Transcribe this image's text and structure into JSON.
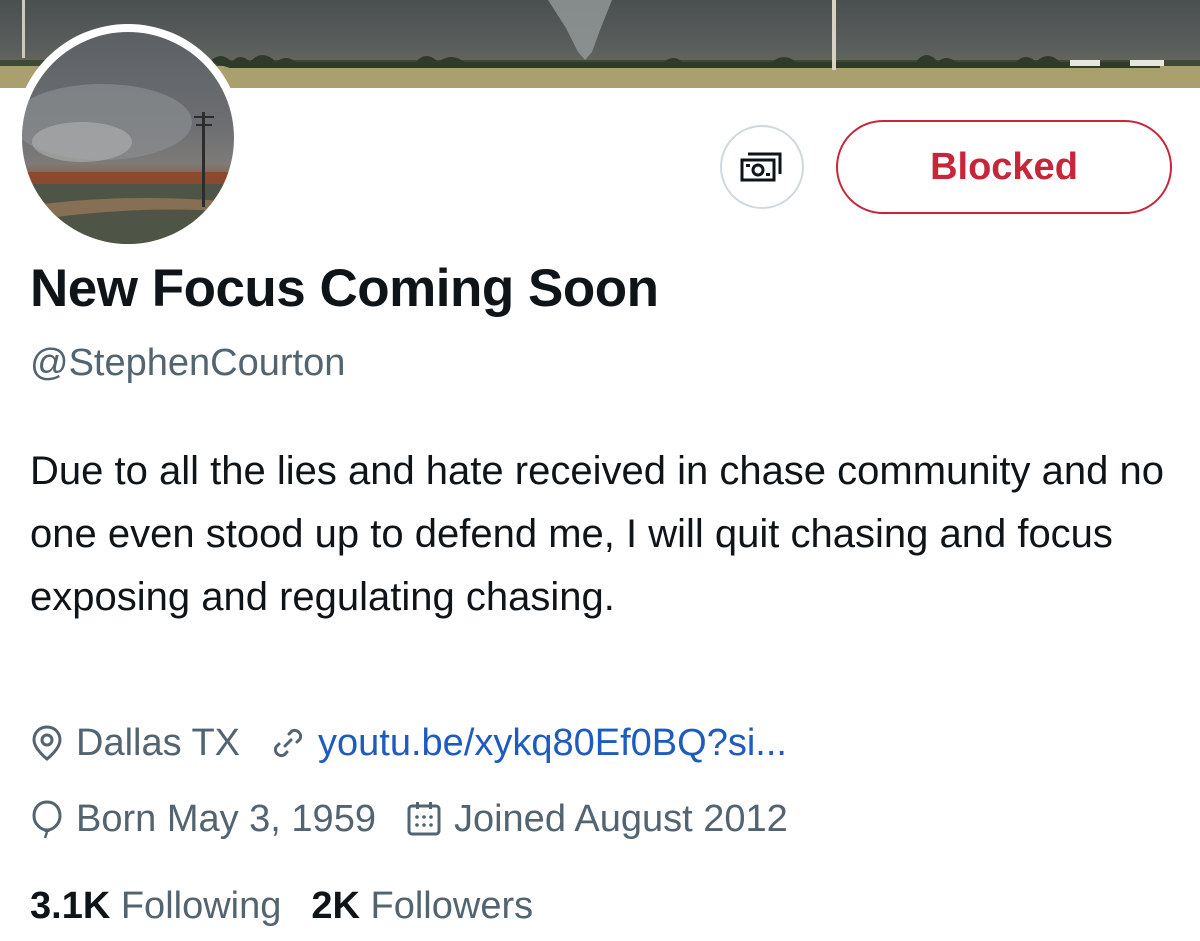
{
  "profile": {
    "display_name": "New Focus Coming Soon",
    "handle": "@StephenCourton",
    "bio": "Due to all the lies and hate received in chase community and no one even stood up to defend me, I will quit chasing and focus exposing and regulating chasing.",
    "location": "Dallas TX",
    "website": "youtu.be/xykq80Ef0BQ?si...",
    "birthday": "Born May 3, 1959",
    "joined": "Joined August 2012"
  },
  "actions": {
    "blocked_label": "Blocked",
    "tip_icon": "money-icon"
  },
  "stats": {
    "following_count": "3.1K",
    "following_label": "Following",
    "followers_count": "2K",
    "followers_label": "Followers"
  },
  "colors": {
    "blocked_red": "#c7253a",
    "link_blue": "#1d5bbf",
    "secondary_text": "#536471"
  }
}
